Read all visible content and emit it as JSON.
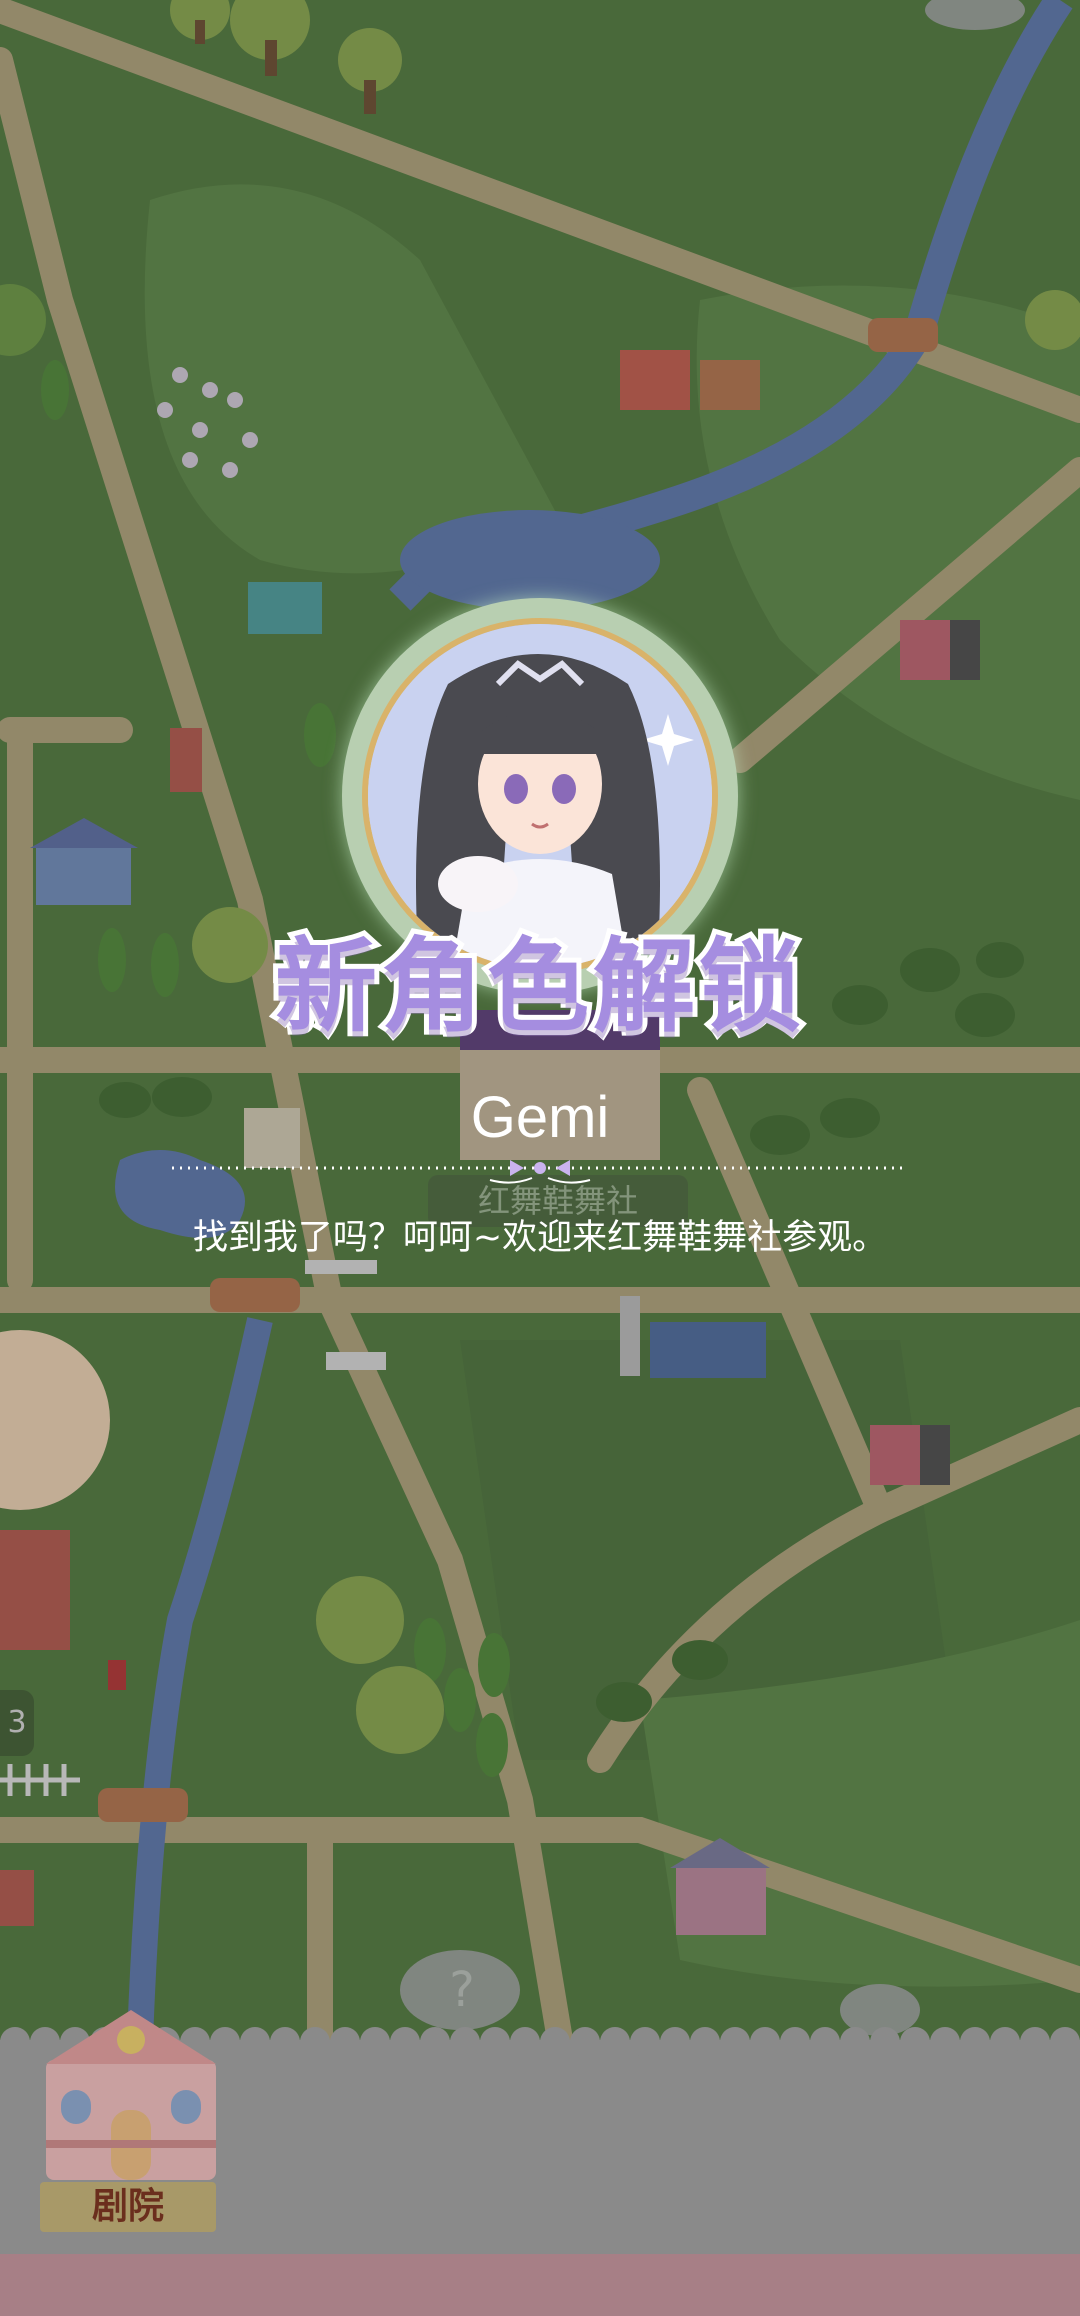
{
  "unlock": {
    "title": "新角色解锁",
    "character_name": "Gemi",
    "dialogue": "找到我了吗？呵呵~欢迎来红舞鞋舞社参观。"
  },
  "map": {
    "place_label": "红舞鞋舞社",
    "side_badge": "3",
    "mystery_icon": "?"
  },
  "bottom_nav": {
    "theater_label": "剧院"
  },
  "colors": {
    "grass": "#4e7a3a",
    "road": "#b3a57a",
    "river": "#5a78b0",
    "title_purple": "#a58de0",
    "ring_green": "#b8cfb1"
  },
  "icons": [
    "theater-building-icon",
    "mystery-location-icon",
    "bow-divider-icon"
  ]
}
